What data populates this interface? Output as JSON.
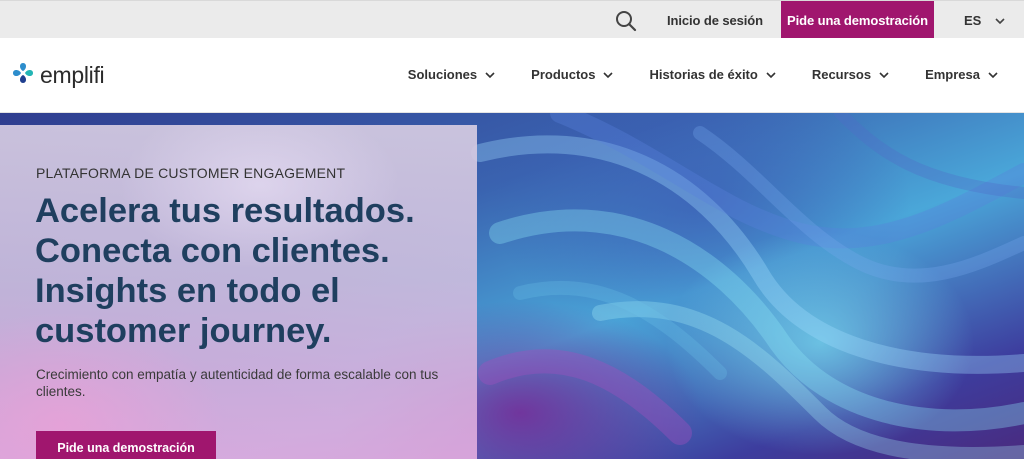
{
  "colors": {
    "brand": "#a0166e",
    "headline": "#1f3f5f",
    "logo_blue": "#2d8dcc",
    "logo_navy": "#1f3f8f",
    "logo_teal": "#23b5b5"
  },
  "utility": {
    "search_icon": "search-icon",
    "login_label": "Inicio de sesión",
    "demo_label": "Pide una demostración",
    "language": "ES",
    "language_icon": "chevron-down-icon"
  },
  "nav": {
    "logo_text": "emplifi",
    "items": [
      {
        "label": "Soluciones"
      },
      {
        "label": "Productos"
      },
      {
        "label": "Historias de éxito"
      },
      {
        "label": "Recursos"
      },
      {
        "label": "Empresa"
      }
    ]
  },
  "hero": {
    "eyebrow": "PLATAFORMA DE CUSTOMER ENGAGEMENT",
    "headline_lines": [
      "Acelera tus resultados.",
      "Conecta con clientes.",
      "Insights en todo el",
      "customer journey."
    ],
    "subcopy": "Crecimiento con empatía y autenticidad de forma escalable con tus clientes.",
    "cta_label": "Pide una demostración"
  }
}
